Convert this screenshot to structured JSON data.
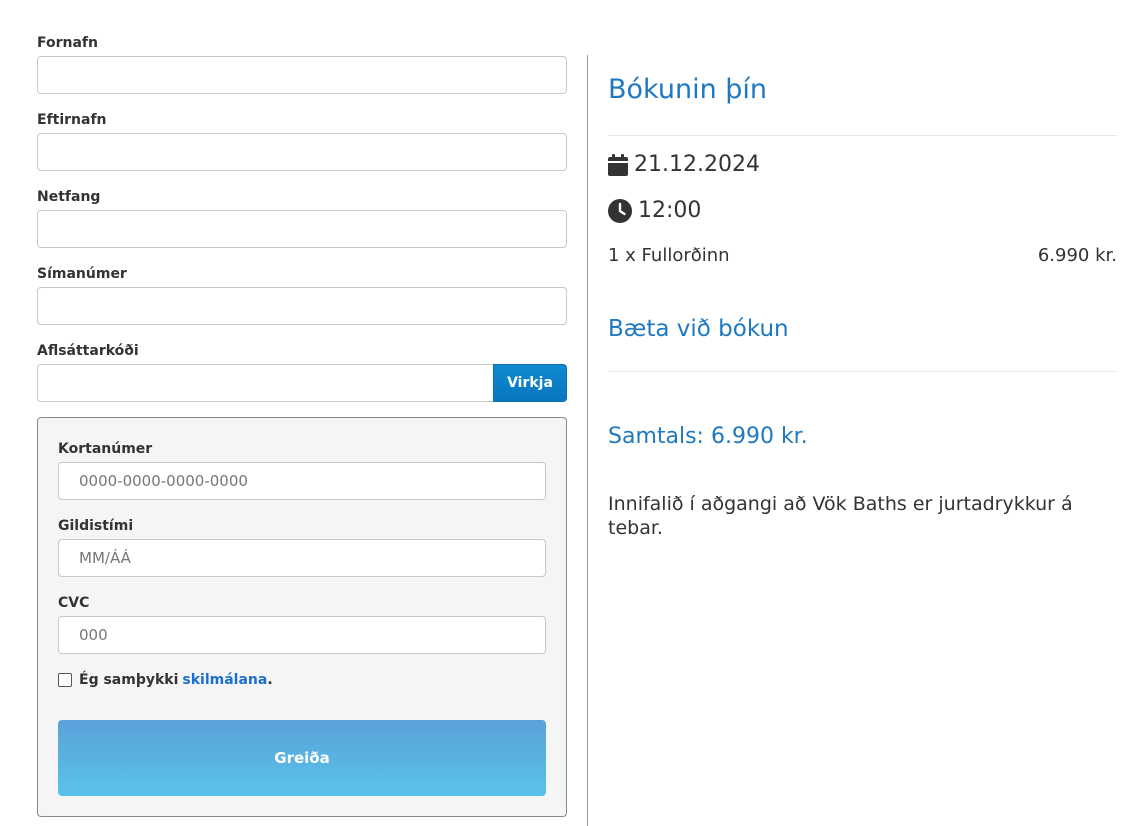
{
  "form": {
    "first_name_label": "Fornafn",
    "last_name_label": "Eftirnafn",
    "email_label": "Netfang",
    "phone_label": "Símanúmer",
    "coupon_label": "Aflsáttarkóði",
    "coupon_button": "Virkja"
  },
  "payment": {
    "card_number_label": "Kortanúmer",
    "card_number_placeholder": "0000-0000-0000-0000",
    "expiry_label": "Gildistími",
    "expiry_placeholder": "MM/ÁÁ",
    "cvc_label": "CVC",
    "cvc_placeholder": "000",
    "terms_text": "Ég samþykki",
    "terms_link": "skilmálana",
    "terms_period": ".",
    "pay_button": "Greiða"
  },
  "summary": {
    "title": "Bókunin þín",
    "date": "21.12.2024",
    "time": "12:00",
    "item_label": "1 x Fullorðinn",
    "item_price": "6.990 kr.",
    "add_booking": "Bæta við bókun",
    "total": "Samtals: 6.990 kr.",
    "note": "Innifalið í aðgangi að Vök Baths er jurtadrykkur á tebar."
  },
  "colors": {
    "accent": "#1e78c2",
    "button_blue": "#0876bd",
    "pay_gradient_top": "#5aa2da",
    "pay_gradient_bottom": "#5ac2ea",
    "link": "#1a6fd0"
  },
  "icons": {
    "date": "calendar-icon",
    "time": "clock-icon"
  }
}
